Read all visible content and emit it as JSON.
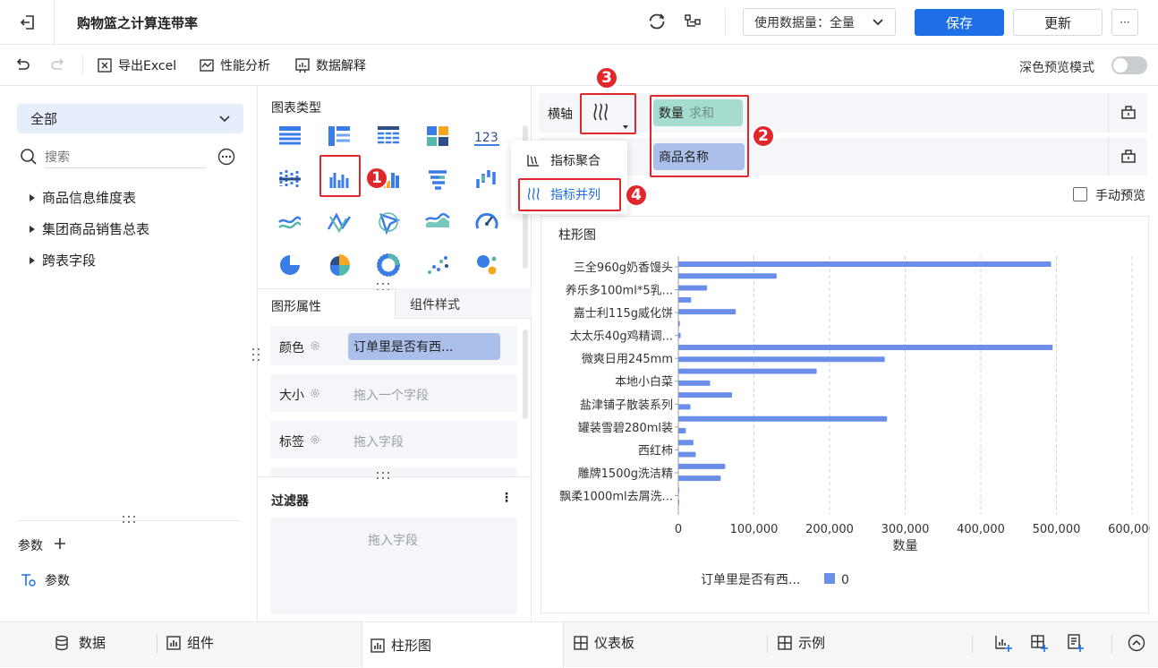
{
  "header": {
    "title": "购物篮之计算连带率",
    "data_amount_label": "使用数据量：全量",
    "save_label": "保存",
    "update_label": "更新",
    "more_label": "···"
  },
  "toolbar": {
    "export_label": "导出Excel",
    "perf_label": "性能分析",
    "explain_label": "数据解释",
    "dark_preview_label": "深色预览模式"
  },
  "left": {
    "dropdown_value": "全部",
    "search_placeholder": "搜索",
    "tree": [
      {
        "label": "商品信息维度表"
      },
      {
        "label": "集团商品销售总表"
      },
      {
        "label": "跨表字段"
      }
    ],
    "params_label": "参数",
    "param_item": "参数"
  },
  "middle": {
    "chart_types_label": "图表类型",
    "numeric_icon_text": "123",
    "tabs": {
      "props": "图形属性",
      "style": "组件样式"
    },
    "props": {
      "color_label": "颜色",
      "color_value": "订单里是否有西...",
      "size_label": "大小",
      "size_placeholder": "拖入一个字段",
      "label_label": "标签",
      "label_placeholder": "拖入字段"
    },
    "filter_label": "过滤器",
    "filter_placeholder": "拖入字段",
    "filter_more": "⋮"
  },
  "popup": {
    "items": [
      {
        "label": "指标聚合"
      },
      {
        "label": "指标并列"
      }
    ]
  },
  "right": {
    "x_axis_label": "横轴",
    "x_chip_name": "数量",
    "x_chip_agg": "求和",
    "y_chip": "商品名称",
    "manual_preview_label": "手动预览"
  },
  "badges": [
    "1",
    "2",
    "3",
    "4"
  ],
  "chart_data": {
    "type": "bar",
    "orientation": "horizontal",
    "title": "柱形图",
    "xlabel": "数量",
    "xlim": [
      0,
      600000
    ],
    "x_ticks": [
      0,
      100000,
      200000,
      300000,
      400000,
      500000,
      600000
    ],
    "x_tick_labels": [
      "0",
      "100,000",
      "200,000",
      "300,000",
      "400,000",
      "500,000",
      "600,000"
    ],
    "grid": true,
    "y_labels": [
      "三全960g奶香馒头",
      "养乐多100ml*5乳...",
      "嘉士利115g威化饼",
      "太太乐40g鸡精调...",
      "微爽日用245mm",
      "本地小白菜",
      "盐津铺子散装系列",
      "罐装雪碧280ml装",
      "西红柿",
      "雕牌1500g洗洁精",
      "飘柔1000ml去屑洗..."
    ],
    "values": [
      493000,
      130000,
      38000,
      17000,
      76000,
      2000,
      3000,
      495000,
      273000,
      183000,
      42000,
      71000,
      16000,
      276000,
      10000,
      20000,
      23000,
      62000,
      56000,
      1000,
      1000
    ],
    "color": "#6b8ee8",
    "legend": {
      "title": "订单里是否有西...",
      "entries": [
        "0"
      ],
      "placement": "bottom"
    }
  },
  "bottom": {
    "data_tab": "数据",
    "component_tab": "组件",
    "bar_chart_tab": "柱形图",
    "dashboard_tab": "仪表板",
    "example_tab": "示例"
  },
  "colors": {
    "primary": "#1e6fe5",
    "teal_chip": "#a6dccf",
    "blue_chip": "#aabfea",
    "badge_red": "#e0282c"
  }
}
